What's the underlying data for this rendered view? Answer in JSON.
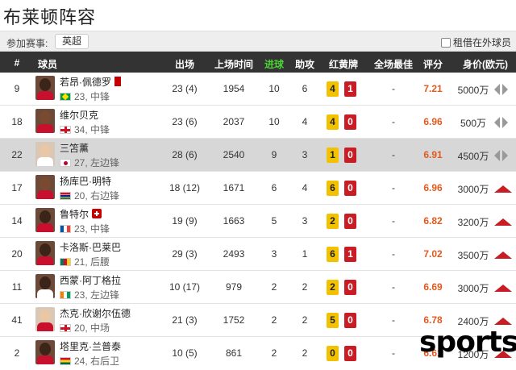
{
  "page": {
    "title": "布莱顿阵容"
  },
  "filter": {
    "label": "参加赛事:",
    "league": "英超",
    "loan_label": "租借在外球员"
  },
  "columns": {
    "num": "#",
    "player": "球员",
    "apps": "出场",
    "minutes": "上场时间",
    "goals": "进球",
    "assists": "助攻",
    "cards": "红黄牌",
    "motm": "全场最佳",
    "rating": "评分",
    "value": "身价(欧元)"
  },
  "colors": {
    "header_bg": "#333333",
    "goals_header": "#4cd137",
    "rating": "#e05a1f",
    "yellow_card": "#f2c200",
    "red_card": "#c81d25"
  },
  "players": [
    {
      "num": "9",
      "name": "若昂·佩德罗",
      "flag": "brazil-flag-icon",
      "meta": "23, 中锋",
      "apps": "23 (4)",
      "minutes": "1954",
      "goals": "10",
      "assists": "6",
      "yellow": "4",
      "red": "1",
      "motm": "-",
      "rating": "7.21",
      "value": "5000万",
      "trend": "flat",
      "status_icon": "red-card-icon"
    },
    {
      "num": "18",
      "name": "维尔贝克",
      "flag": "england-flag-icon",
      "meta": "34, 中锋",
      "apps": "23 (6)",
      "minutes": "2037",
      "goals": "10",
      "assists": "4",
      "yellow": "4",
      "red": "0",
      "motm": "-",
      "rating": "6.96",
      "value": "500万",
      "trend": "flat"
    },
    {
      "num": "22",
      "name": "三笘薰",
      "flag": "japan-flag-icon",
      "meta": "27, 左边锋",
      "apps": "28 (6)",
      "minutes": "2540",
      "goals": "9",
      "assists": "3",
      "yellow": "1",
      "red": "0",
      "motm": "-",
      "rating": "6.91",
      "value": "4500万",
      "trend": "flat"
    },
    {
      "num": "17",
      "name": "扬库巴·明特",
      "flag": "gambia-flag-icon",
      "meta": "20, 右边锋",
      "apps": "18 (12)",
      "minutes": "1671",
      "goals": "6",
      "assists": "4",
      "yellow": "6",
      "red": "0",
      "motm": "-",
      "rating": "6.96",
      "value": "3000万",
      "trend": "up"
    },
    {
      "num": "14",
      "name": "鲁特尔",
      "flag": "france-flag-icon",
      "meta": "23, 中锋",
      "apps": "19 (9)",
      "minutes": "1663",
      "goals": "5",
      "assists": "3",
      "yellow": "2",
      "red": "0",
      "motm": "-",
      "rating": "6.82",
      "value": "3200万",
      "trend": "up",
      "status_icon": "injury-icon"
    },
    {
      "num": "20",
      "name": "卡洛斯·巴莱巴",
      "flag": "cameroon-flag-icon",
      "meta": "21, 后腰",
      "apps": "29 (3)",
      "minutes": "2493",
      "goals": "3",
      "assists": "1",
      "yellow": "6",
      "red": "1",
      "motm": "-",
      "rating": "7.02",
      "value": "3500万",
      "trend": "up"
    },
    {
      "num": "11",
      "name": "西蒙·阿丁格拉",
      "flag": "ivory-coast-flag-icon",
      "meta": "23, 左边锋",
      "apps": "10 (17)",
      "minutes": "979",
      "goals": "2",
      "assists": "2",
      "yellow": "2",
      "red": "0",
      "motm": "-",
      "rating": "6.69",
      "value": "3000万",
      "trend": "up"
    },
    {
      "num": "41",
      "name": "杰克·欣谢尔伍德",
      "flag": "england-flag-icon",
      "meta": "20, 中场",
      "apps": "21 (3)",
      "minutes": "1752",
      "goals": "2",
      "assists": "2",
      "yellow": "5",
      "red": "0",
      "motm": "-",
      "rating": "6.78",
      "value": "2400万",
      "trend": "up"
    },
    {
      "num": "2",
      "name": "塔里克·兰普泰",
      "flag": "ghana-flag-icon",
      "meta": "24, 右后卫",
      "apps": "10 (5)",
      "minutes": "861",
      "goals": "2",
      "assists": "2",
      "yellow": "0",
      "red": "0",
      "motm": "-",
      "rating": "6.61",
      "value": "1200万",
      "trend": "up"
    }
  ],
  "watermark": "sports"
}
